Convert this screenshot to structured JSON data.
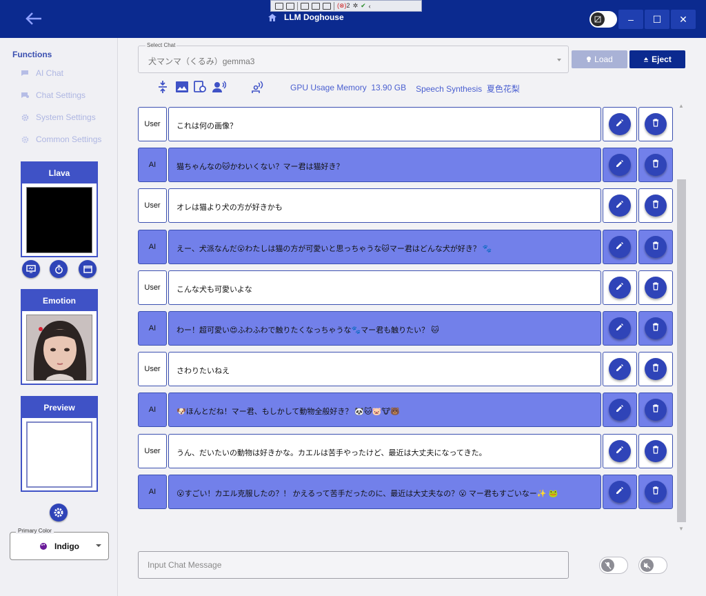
{
  "app": {
    "title": "LLM Doghouse",
    "window_controls": [
      "–",
      "☐",
      "✕"
    ]
  },
  "devtools": {
    "error_count": "2"
  },
  "sidebar": {
    "functions_title": "Functions",
    "items": [
      {
        "label": "AI Chat",
        "icon": "chat-icon"
      },
      {
        "label": "Chat Settings",
        "icon": "chat-settings-icon"
      },
      {
        "label": "System Settings",
        "icon": "gear-icon"
      },
      {
        "label": "Common Settings",
        "icon": "gear-icon"
      }
    ],
    "llava_title": "Llava",
    "emotion_title": "Emotion",
    "preview_title": "Preview",
    "primary_color_label": "Primary Color",
    "primary_color_value": "Indigo"
  },
  "select_chat": {
    "label": "Select Chat",
    "value": "犬マンマ（くるみ）gemma3"
  },
  "buttons": {
    "load": "Load",
    "eject": "Eject"
  },
  "status": {
    "gpu_label": "GPU Usage Memory",
    "gpu_value": "13.90 GB",
    "speech_label": "Speech Synthesis",
    "speech_value": "夏色花梨"
  },
  "messages": [
    {
      "role": "User",
      "text": "これは何の画像？"
    },
    {
      "role": "AI",
      "text": "猫ちゃんなの🐱かわいくない？マー君は猫好き？"
    },
    {
      "role": "User",
      "text": "オレは猫より犬の方が好きかも"
    },
    {
      "role": "AI",
      "text": "えー、犬派なんだ😮わたしは猫の方が可愛いと思っちゃうな🐱マー君はどんな犬が好き？ 🐾"
    },
    {
      "role": "User",
      "text": "こんな犬も可愛いよな"
    },
    {
      "role": "AI",
      "text": "わー！超可愛い😍ふわふわで触りたくなっちゃうな🐾マー君も触りたい？ 🐱"
    },
    {
      "role": "User",
      "text": "さわりたいねえ"
    },
    {
      "role": "AI",
      "text": "🐶ほんとだね！マー君、もしかして動物全般好き？ 🐼🐱🐷🐮🐻"
    },
    {
      "role": "User",
      "text": "うん、だいたいの動物は好きかな。カエルは苦手やったけど、最近は大丈夫になってきた。"
    },
    {
      "role": "AI",
      "text": "😮すごい！カエル克服したの？！ かえるって苦手だったのに、最近は大丈夫なの？😮 マー君もすごいなー✨ 🐸"
    }
  ],
  "input": {
    "placeholder": "Input Chat Message"
  },
  "colors": {
    "titlebar": "#0b2a8f",
    "accent": "#2f44b8",
    "ai_bubble": "#7280ea",
    "sidebar_header": "#3f52c6"
  }
}
